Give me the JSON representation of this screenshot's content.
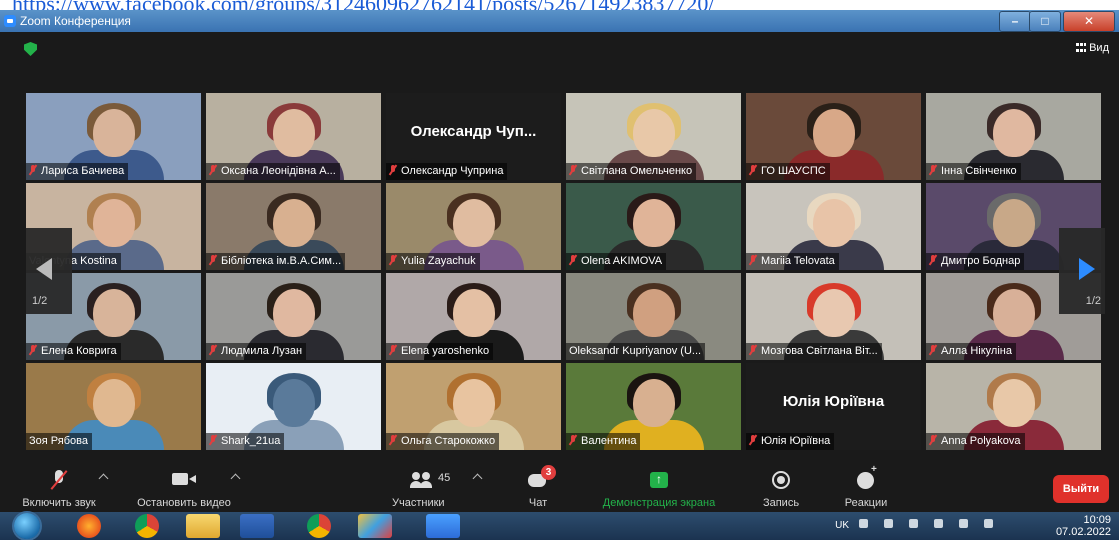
{
  "url_strip": {
    "text": "https://www.facebook.com/groups/312460962762141/posts/526714923837720/"
  },
  "window": {
    "title": "Zoom Конференция"
  },
  "topbar": {
    "view_label": "Вид"
  },
  "pager": {
    "left": "1/2",
    "right": "1/2"
  },
  "tiles": [
    {
      "name": "Лариса Бачиева",
      "muted": true,
      "type": "video",
      "bg": "#8a9fbe",
      "skin": "#d9b49a",
      "hair": "#7a5a3a",
      "shirt": "#3d5a8c"
    },
    {
      "name": "Оксана Леонідівна А...",
      "muted": true,
      "type": "video",
      "bg": "#b8b0a0",
      "skin": "#e0bca0",
      "hair": "#8a3a3a",
      "shirt": "#4a3a5a"
    },
    {
      "name": "Олександр Чуприна",
      "muted": true,
      "type": "text",
      "display": "Олександр  Чуп..."
    },
    {
      "name": "Світлана Омельченко",
      "muted": true,
      "type": "video",
      "bg": "#c6c4b8",
      "skin": "#e8c8a8",
      "hair": "#e0c070",
      "shirt": "#6a4a4a"
    },
    {
      "name": "ГО ШАУСПС",
      "muted": true,
      "type": "video",
      "bg": "#6a4a3a",
      "skin": "#d8a888",
      "hair": "#2a2018",
      "shirt": "#8a2a2a"
    },
    {
      "name": "Інна Свінченко",
      "muted": true,
      "type": "video",
      "bg": "#a8a8a0",
      "skin": "#e0b8a0",
      "hair": "#3a2a28",
      "shirt": "#2a2a30"
    },
    {
      "name": "Valentyna Kostina",
      "muted": false,
      "type": "video",
      "bg": "#c8b4a0",
      "skin": "#e0b498",
      "hair": "#b08050",
      "shirt": "#5a6a8a"
    },
    {
      "name": "Бібліотека ім.В.А.Сим...",
      "muted": true,
      "type": "video",
      "bg": "#8a7a6a",
      "skin": "#d8b090",
      "hair": "#3a2a20",
      "shirt": "#3a4a5a"
    },
    {
      "name": "Yulia Zayachuk",
      "muted": true,
      "type": "video",
      "bg": "#9a8a6a",
      "skin": "#e0bca0",
      "hair": "#4a3020",
      "shirt": "#7a5a8a"
    },
    {
      "name": "Olena AKIMOVA",
      "muted": true,
      "type": "video",
      "bg": "#3a5a4a",
      "skin": "#e0b498",
      "hair": "#2a1a18",
      "shirt": "#2a2a2a"
    },
    {
      "name": "Mariia Telovata",
      "muted": true,
      "type": "video",
      "bg": "#c8c4bc",
      "skin": "#e8c4a8",
      "hair": "#e8d8c0",
      "shirt": "#3a3a4a"
    },
    {
      "name": "Дмитро Боднар",
      "muted": true,
      "type": "video",
      "bg": "#5a4a6a",
      "skin": "#c8a888",
      "hair": "#6a6a6a",
      "shirt": "#2a2a3a"
    },
    {
      "name": "Елена Коврига",
      "muted": true,
      "type": "video",
      "bg": "#8a9aa8",
      "skin": "#d8b49a",
      "hair": "#2a2020",
      "shirt": "#2a2a2a"
    },
    {
      "name": "Людмила Лузан",
      "muted": true,
      "type": "video",
      "bg": "#9a9a98",
      "skin": "#e0b8a0",
      "hair": "#2a2018",
      "shirt": "#2a2a30"
    },
    {
      "name": "Elena yaroshenko",
      "muted": true,
      "type": "video",
      "bg": "#b0a8a8",
      "skin": "#e4c0a4",
      "hair": "#2a1c18",
      "shirt": "#1a1a1a"
    },
    {
      "name": "Oleksandr Kupriyanov (U...",
      "muted": false,
      "type": "video",
      "bg": "#8a8a80",
      "skin": "#d0a080",
      "hair": "#4a3020",
      "shirt": "#4a4a4a"
    },
    {
      "name": "Мозгова Світлана Віт...",
      "muted": true,
      "type": "video",
      "bg": "#c4c0b8",
      "skin": "#e8c8b0",
      "hair": "#d83a2a",
      "shirt": "#3a3a3a"
    },
    {
      "name": "Алла Нікуліна",
      "muted": true,
      "type": "video",
      "bg": "#a09c98",
      "skin": "#d8b098",
      "hair": "#4a2a1a",
      "shirt": "#5a2a4a"
    },
    {
      "name": "Зоя Рябова",
      "muted": false,
      "type": "video",
      "active": true,
      "bg": "#9a7a4a",
      "skin": "#e0b890",
      "hair": "#c08040",
      "shirt": "#4a8ab8"
    },
    {
      "name": "Shark_21ua",
      "muted": true,
      "type": "avatar",
      "bg": "#e8eef4",
      "skin": "#5a7a9a",
      "hair": "#3a5a7a",
      "shirt": "#8aa0b8"
    },
    {
      "name": "Ольга Старокожко",
      "muted": true,
      "type": "video",
      "bg": "#c0a070",
      "skin": "#e8c4a0",
      "hair": "#b07030",
      "shirt": "#d8c8a0"
    },
    {
      "name": "Валентина",
      "muted": true,
      "type": "video",
      "bg": "#5a7a3a",
      "skin": "#d8b090",
      "hair": "#1a1410",
      "shirt": "#e0b020"
    },
    {
      "name": "Юлія Юріївна",
      "muted": true,
      "type": "text",
      "display": "Юлія Юріївна"
    },
    {
      "name": "Anna Polyakova",
      "muted": true,
      "type": "video",
      "bg": "#b8b4a8",
      "skin": "#e8c8a8",
      "hair": "#b07a4a",
      "shirt": "#8a2a3a"
    }
  ],
  "toolbar": {
    "unmute_label": "Включить звук",
    "stop_video_label": "Остановить видео",
    "participants_label": "Участники",
    "participants_count": "45",
    "chat_label": "Чат",
    "chat_badge": "3",
    "share_label": "Демонстрация экрана",
    "record_label": "Запись",
    "reactions_label": "Реакции",
    "leave_label": "Выйти"
  },
  "taskbar": {
    "language": "UK",
    "time": "10:09",
    "date": "07.02.2022",
    "apps": [
      "firefox-icon",
      "chrome-icon",
      "file-explorer-icon",
      "word-icon",
      "chrome-icon",
      "paint-icon",
      "zoom-icon"
    ]
  },
  "colors": {
    "share_accent": "#23b24a",
    "leave_red": "#e0312b",
    "active_speaker": "#c8e04a",
    "muted_icon": "#e13e3e"
  }
}
